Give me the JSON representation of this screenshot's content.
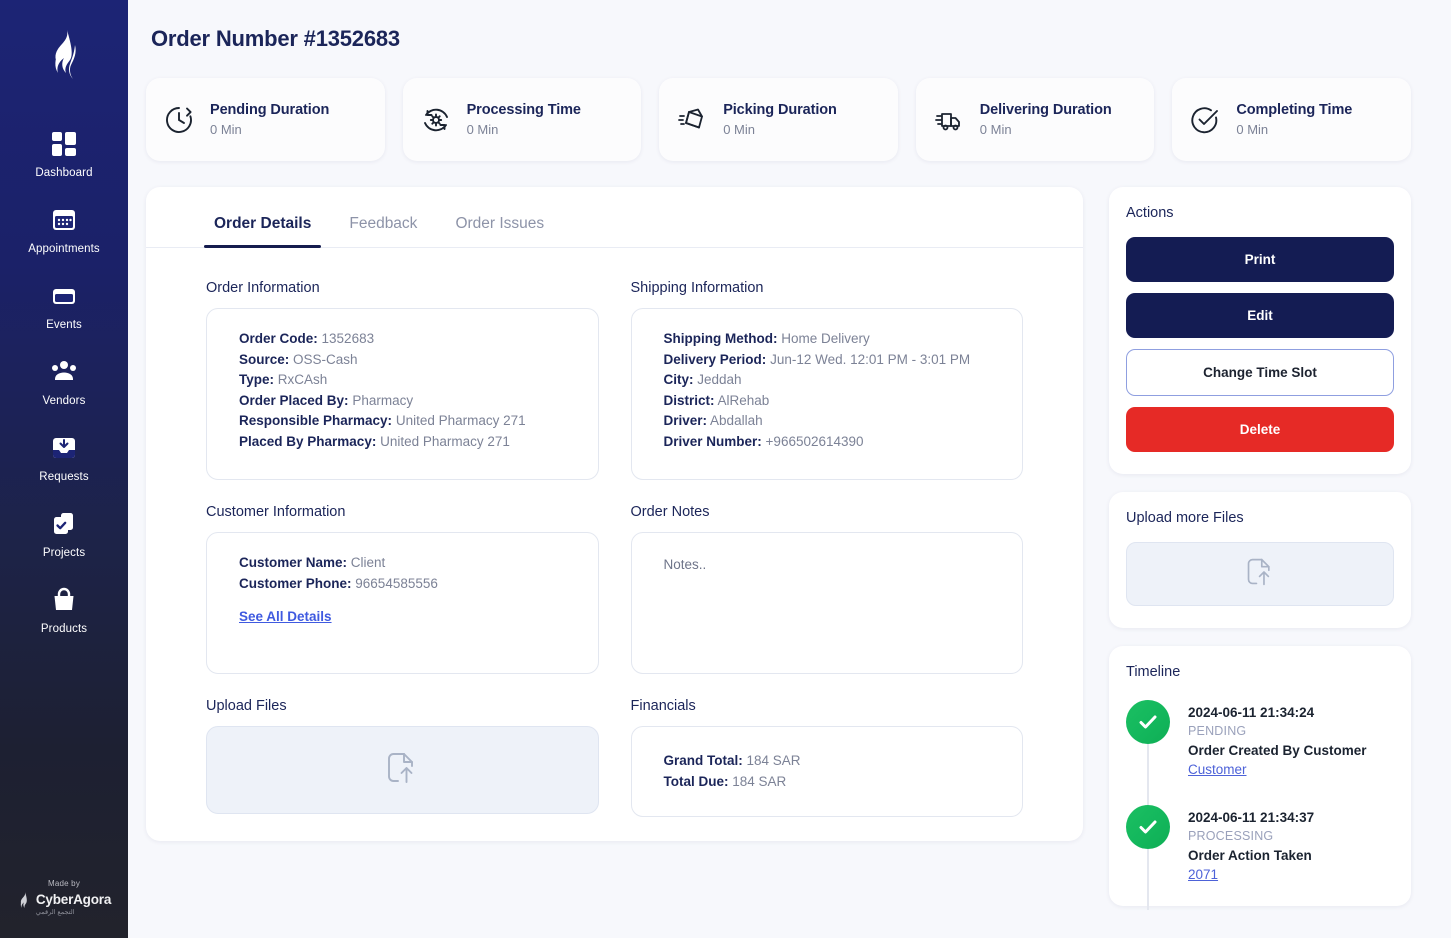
{
  "sidebar": {
    "logo_icon": "flame-logo-icon",
    "items": [
      {
        "label": "Dashboard",
        "icon": "grid-dashboard-icon"
      },
      {
        "label": "Appointments",
        "icon": "calendar-icon"
      },
      {
        "label": "Events",
        "icon": "card-events-icon"
      },
      {
        "label": "Vendors",
        "icon": "people-group-icon"
      },
      {
        "label": "Requests",
        "icon": "inbox-download-icon"
      },
      {
        "label": "Projects",
        "icon": "clipboard-check-icon"
      },
      {
        "label": "Products",
        "icon": "shopping-bag-icon"
      }
    ],
    "footer": {
      "made_by": "Made by",
      "brand": "CyberAgora",
      "brand_arabic": "التجمع الرقمي"
    }
  },
  "header": {
    "title": "Order Number #1352683"
  },
  "stats": [
    {
      "icon": "clock-pending-icon",
      "title": "Pending Duration",
      "value": "0 Min"
    },
    {
      "icon": "gear-processing-icon",
      "title": "Processing Time",
      "value": "0 Min"
    },
    {
      "icon": "box-picking-icon",
      "title": "Picking Duration",
      "value": "0 Min"
    },
    {
      "icon": "truck-delivery-icon",
      "title": "Delivering Duration",
      "value": "0 Min"
    },
    {
      "icon": "check-circle-icon",
      "title": "Completing Time",
      "value": "0 Min"
    }
  ],
  "tabs": [
    {
      "label": "Order Details",
      "active": true
    },
    {
      "label": "Feedback",
      "active": false
    },
    {
      "label": "Order Issues",
      "active": false
    }
  ],
  "order_information": {
    "section_label": "Order Information",
    "rows": [
      {
        "label": "Order Code:",
        "value": "1352683"
      },
      {
        "label": "Source:",
        "value": "OSS-Cash"
      },
      {
        "label": "Type:",
        "value": "RxCAsh"
      },
      {
        "label": "Order Placed By:",
        "value": "Pharmacy"
      },
      {
        "label": "Responsible Pharmacy:",
        "value": "United Pharmacy 271"
      },
      {
        "label": "Placed By Pharmacy:",
        "value": "United Pharmacy 271"
      }
    ]
  },
  "shipping_information": {
    "section_label": "Shipping Information",
    "rows": [
      {
        "label": "Shipping Method:",
        "value": "Home Delivery"
      },
      {
        "label": "Delivery Period:",
        "value": "Jun-12 Wed. 12:01 PM - 3:01 PM"
      },
      {
        "label": "City:",
        "value": "Jeddah"
      },
      {
        "label": "District:",
        "value": "AlRehab"
      },
      {
        "label": "Driver:",
        "value": "Abdallah"
      },
      {
        "label": "Driver Number:",
        "value": "+966502614390"
      }
    ]
  },
  "customer_information": {
    "section_label": "Customer Information",
    "rows": [
      {
        "label": "Customer Name:",
        "value": "Client"
      },
      {
        "label": "Customer Phone:",
        "value": "96654585556"
      }
    ],
    "see_all_details": "See All Details"
  },
  "order_notes": {
    "section_label": "Order Notes",
    "placeholder": "Notes..",
    "value": ""
  },
  "upload_files": {
    "section_label": "Upload Files",
    "icon": "file-upload-icon"
  },
  "financials": {
    "section_label": "Financials",
    "rows": [
      {
        "label": "Grand Total:",
        "value": "184 SAR"
      },
      {
        "label": "Total Due:",
        "value": "184 SAR"
      }
    ]
  },
  "actions": {
    "title": "Actions",
    "buttons": [
      {
        "label": "Print",
        "style": "primary"
      },
      {
        "label": "Edit",
        "style": "primary"
      },
      {
        "label": "Change Time Slot",
        "style": "outline"
      },
      {
        "label": "Delete",
        "style": "danger"
      }
    ]
  },
  "upload_more": {
    "title": "Upload more Files",
    "icon": "file-upload-icon"
  },
  "timeline": {
    "title": "Timeline",
    "entries": [
      {
        "time": "2024-06-11 21:34:24",
        "status": "PENDING",
        "description": "Order Created By Customer",
        "link": "Customer"
      },
      {
        "time": "2024-06-11 21:34:37",
        "status": "PROCESSING",
        "description": "Order Action Taken",
        "link": "2071"
      }
    ]
  },
  "colors": {
    "navy": "#141c53",
    "danger": "#e62a26",
    "success": "#14b85d",
    "link": "#3f5ae0",
    "muted": "#7c8296"
  }
}
